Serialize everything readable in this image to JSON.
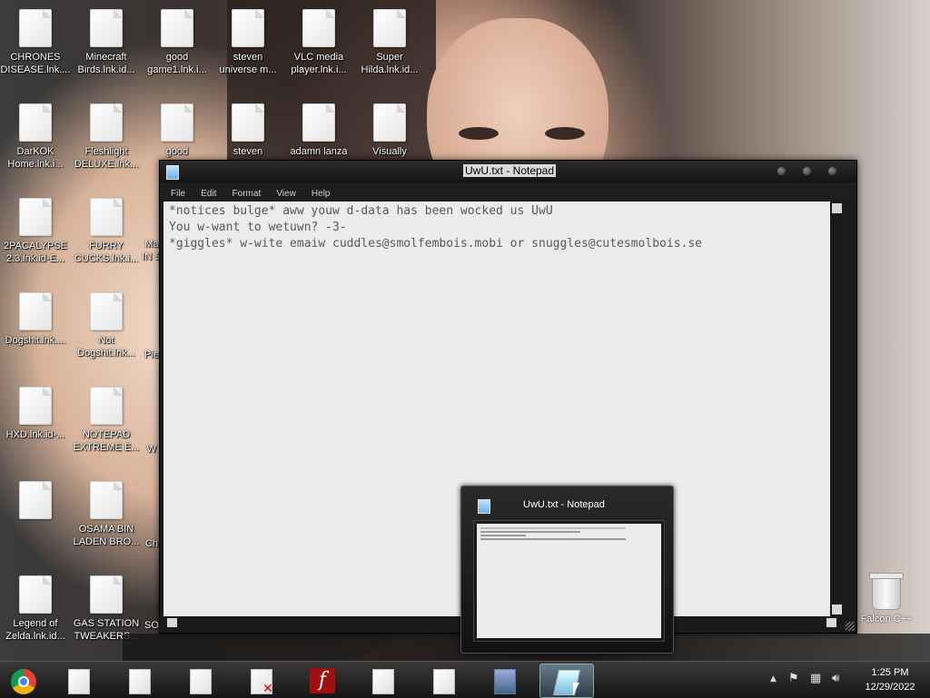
{
  "desktop_icons": [
    {
      "label": "CHRONES\nDISEASE.lnk...."
    },
    {
      "label": "Minecraft\nBirds.lnk.id..."
    },
    {
      "label": "good\ngame1.lnk.i..."
    },
    {
      "label": "steven\nuniverse m..."
    },
    {
      "label": "VLC media\nplayer.lnk.i..."
    },
    {
      "label": "Super\nHilda.lnk.id..."
    },
    {
      "label": "DarKOK\nHome.lnk.i..."
    },
    {
      "label": "Fleshlight\nDELUXE.lnk..."
    },
    {
      "label": "good\ngam"
    },
    {
      "label": "steven"
    },
    {
      "label": "adamn lanza"
    },
    {
      "label": "Visually"
    },
    {
      "label": "2PACALYPSE\n2.3.lnk.id-E..."
    },
    {
      "label": "FURRY\nCUCKS.lnk.i..."
    },
    {
      "label": "Ma\nIN S"
    },
    {
      "label": "Dogshit.lnk...."
    },
    {
      "label": "Not\nDogshit.lnk..."
    },
    {
      "label": "Pie"
    },
    {
      "label": "HXD.lnk.id-..."
    },
    {
      "label": "NOTEPAD\nEXTREME E..."
    },
    {
      "label": "W"
    },
    {
      "label": ""
    },
    {
      "label": "OSAMA BIN\nLADEN BRO..."
    },
    {
      "label": "Ch"
    },
    {
      "label": "Legend of\nZelda.lnk.id..."
    },
    {
      "label": "GAS STATION\nTWEAKERS..."
    },
    {
      "label": "SO"
    }
  ],
  "recycle_bin": {
    "label": "Falcon C++"
  },
  "notepad": {
    "title": "UwU.txt - Notepad",
    "menu": [
      "File",
      "Edit",
      "Format",
      "View",
      "Help"
    ],
    "content": "*notices bulge* aww youw d-data has been wocked us UwU\nYou w-want to wetuwn? -3-\n*giggles* w-wite emaiw cuddles@smolfembois.mobi or snuggles@cutesmolbois.se"
  },
  "preview": {
    "title": "UwU.txt - Notepad"
  },
  "taskbar": {
    "items": [
      "chrome",
      "document",
      "document",
      "document",
      "document-error",
      "flash-player",
      "document",
      "document",
      "installer",
      "notepad"
    ],
    "clock_time": "1:25 PM",
    "clock_date": "12/29/2022"
  }
}
